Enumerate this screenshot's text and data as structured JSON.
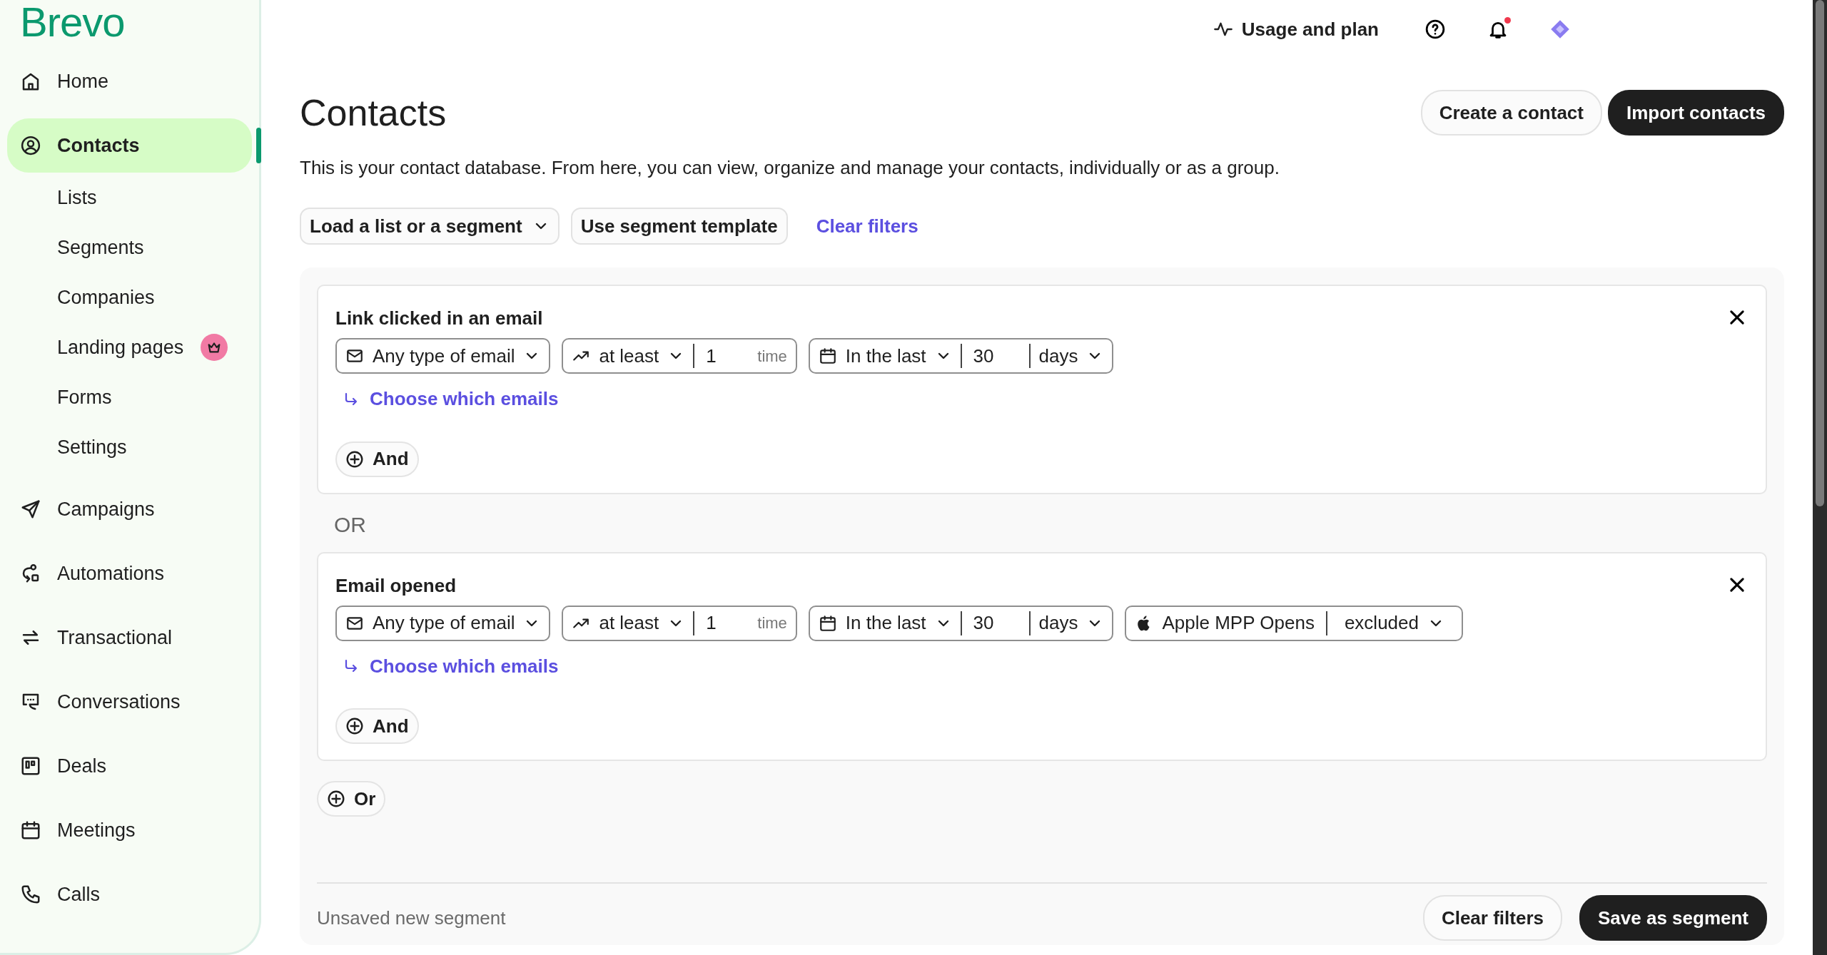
{
  "logo": "Brevo",
  "sidebar": {
    "items": [
      {
        "label": "Home",
        "selected": false
      },
      {
        "label": "Contacts",
        "selected": true,
        "children": [
          {
            "label": "Lists",
            "premium": false
          },
          {
            "label": "Segments",
            "premium": false
          },
          {
            "label": "Companies",
            "premium": false
          },
          {
            "label": "Landing pages",
            "premium": true
          },
          {
            "label": "Forms",
            "premium": false
          },
          {
            "label": "Settings",
            "premium": false
          }
        ]
      },
      {
        "label": "Campaigns",
        "selected": false
      },
      {
        "label": "Automations",
        "selected": false
      },
      {
        "label": "Transactional",
        "selected": false
      },
      {
        "label": "Conversations",
        "selected": false
      },
      {
        "label": "Deals",
        "selected": false
      },
      {
        "label": "Meetings",
        "selected": false
      },
      {
        "label": "Calls",
        "selected": false
      }
    ]
  },
  "topbar": {
    "usage": "Usage and plan",
    "notifications_unread": true
  },
  "page": {
    "title": "Contacts",
    "description": "This is your contact database. From here, you can view, organize and manage your contacts, individually or as a group.",
    "buttons": [
      {
        "label": "Create a contact",
        "kind": "secondary"
      },
      {
        "label": "Import contacts",
        "kind": "primary"
      }
    ]
  },
  "toolbar": {
    "load": "Load a list or a segment",
    "template": "Use segment template",
    "clear": "Clear filters"
  },
  "groups": [
    {
      "title": "Link clicked in an email",
      "controls": [
        {
          "kind": "email",
          "value": "Any type of email"
        },
        {
          "kind": "count",
          "operator": "at least",
          "value": "1",
          "unit": "time"
        },
        {
          "kind": "period",
          "operator": "In the last",
          "value": "30",
          "unit": "days"
        }
      ],
      "link": "Choose which emails",
      "and": "And"
    },
    {
      "title": "Email opened",
      "controls": [
        {
          "kind": "email",
          "value": "Any type of email"
        },
        {
          "kind": "count",
          "operator": "at least",
          "value": "1",
          "unit": "time"
        },
        {
          "kind": "period",
          "operator": "In the last",
          "value": "30",
          "unit": "days"
        },
        {
          "kind": "apple",
          "label": "Apple MPP Opens",
          "value": "excluded"
        }
      ],
      "link": "Choose which emails",
      "and": "And"
    }
  ],
  "separator": "OR",
  "or_button": "Or",
  "footer": {
    "status": "Unsaved new segment",
    "buttons": [
      {
        "label": "Clear filters",
        "kind": "secondary"
      },
      {
        "label": "Save as segment",
        "kind": "primary"
      }
    ]
  }
}
